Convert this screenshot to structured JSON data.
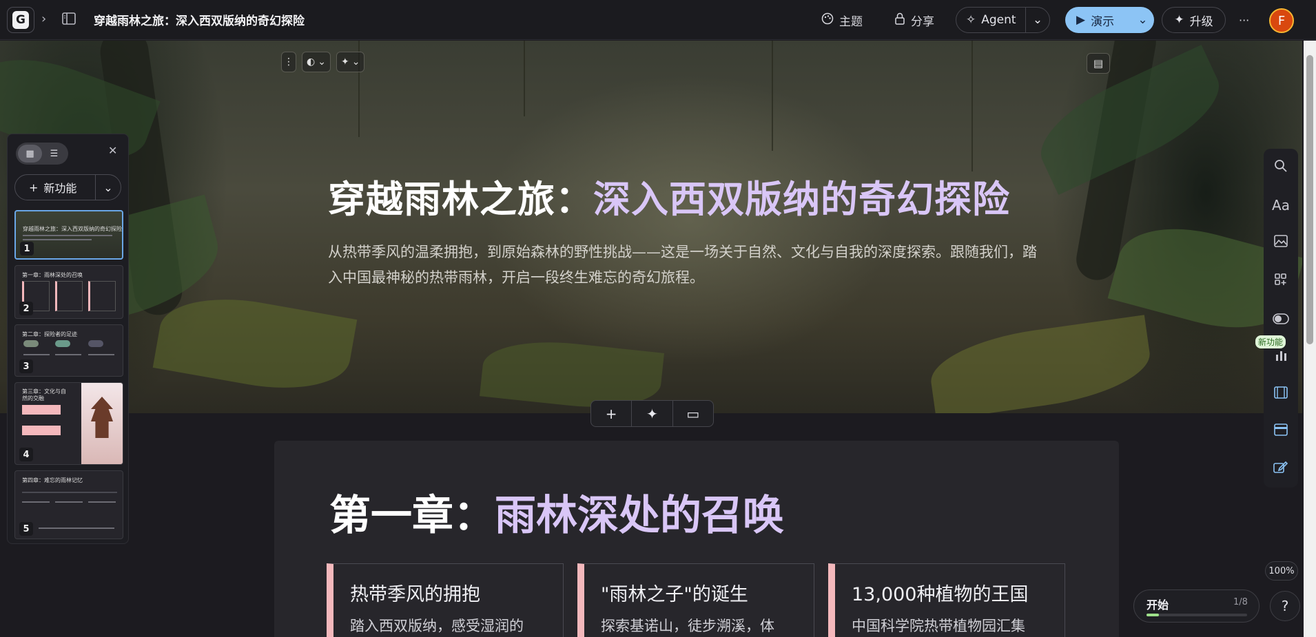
{
  "topbar": {
    "logo_letter": "G",
    "doc_title": "穿越雨林之旅：深入西双版纳的奇幻探险",
    "theme_label": "主题",
    "share_label": "分享",
    "agent_label": "Agent",
    "present_label": "演示",
    "upgrade_label": "升级",
    "more_label": "···",
    "avatar_letter": "F"
  },
  "hero": {
    "title_main": "穿越雨林之旅：",
    "title_accent": "深入西双版纳的奇幻探险",
    "subtitle": "从热带季风的温柔拥抱，到原始森林的野性挑战——这是一场关于自然、文化与自我的深度探索。跟随我们，踏入中国最神秘的热带雨林，开启一段终生难忘的奇幻旅程。"
  },
  "chapter1": {
    "title_main": "第一章：",
    "title_accent": "雨林深处的召唤",
    "cards": [
      {
        "heading": "热带季风的拥抱",
        "body": "踏入西双版纳，感受湿润的"
      },
      {
        "heading": "\"雨林之子\"的诞生",
        "body": "探索基诺山，徒步溯溪，体"
      },
      {
        "heading": "13,000种植物的王国",
        "body": "中国科学院热带植物园汇集"
      }
    ]
  },
  "left_panel": {
    "new_feature_label": "新功能",
    "thumbnails": [
      {
        "num": "1",
        "title": "穿越雨林之旅：深入西双版纳的奇幻探险"
      },
      {
        "num": "2",
        "title": "第一章：雨林深处的召唤"
      },
      {
        "num": "3",
        "title": "第二章：探险者的足迹"
      },
      {
        "num": "4",
        "title": "第三章：文化与自然的交融"
      },
      {
        "num": "5",
        "title": "第四章：难忘的雨林记忆"
      }
    ]
  },
  "right_rail": {
    "new_badge": "新功能",
    "text_icon": "Aa",
    "zoom": "100%",
    "help": "?"
  },
  "onboarding": {
    "label": "开始",
    "progress_text": "1/8",
    "progress": 0.125
  },
  "colors": {
    "accent_purple": "#d9c6f7",
    "present_blue": "#8cc4f5",
    "card_stripe": "#f4b8bc",
    "selected_border": "#6aa7e8"
  }
}
